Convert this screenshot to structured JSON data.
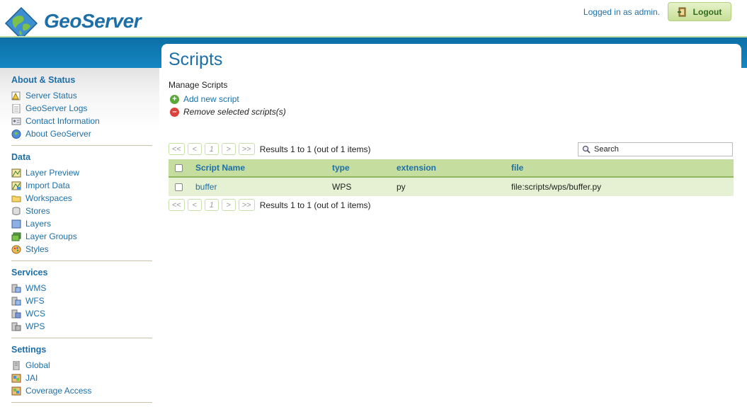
{
  "header": {
    "brand": "GeoServer",
    "logged_in": "Logged in as admin.",
    "logout_label": "Logout"
  },
  "sidebar": {
    "sections": [
      {
        "title": "About & Status",
        "items": [
          {
            "label": "Server Status",
            "icon": "server-status-icon"
          },
          {
            "label": "GeoServer Logs",
            "icon": "logs-icon"
          },
          {
            "label": "Contact Information",
            "icon": "contact-icon"
          },
          {
            "label": "About GeoServer",
            "icon": "about-icon"
          }
        ]
      },
      {
        "title": "Data",
        "items": [
          {
            "label": "Layer Preview",
            "icon": "layer-preview-icon"
          },
          {
            "label": "Import Data",
            "icon": "import-data-icon"
          },
          {
            "label": "Workspaces",
            "icon": "folder-icon"
          },
          {
            "label": "Stores",
            "icon": "store-icon"
          },
          {
            "label": "Layers",
            "icon": "layers-icon"
          },
          {
            "label": "Layer Groups",
            "icon": "layer-groups-icon"
          },
          {
            "label": "Styles",
            "icon": "styles-icon"
          }
        ]
      },
      {
        "title": "Services",
        "items": [
          {
            "label": "WMS",
            "icon": "wms-icon"
          },
          {
            "label": "WFS",
            "icon": "wfs-icon"
          },
          {
            "label": "WCS",
            "icon": "wcs-icon"
          },
          {
            "label": "WPS",
            "icon": "wps-icon"
          }
        ]
      },
      {
        "title": "Settings",
        "items": [
          {
            "label": "Global",
            "icon": "global-icon"
          },
          {
            "label": "JAI",
            "icon": "jai-icon"
          },
          {
            "label": "Coverage Access",
            "icon": "coverage-access-icon"
          }
        ]
      }
    ]
  },
  "main": {
    "title": "Scripts",
    "subtitle": "Manage Scripts",
    "add_label": "Add new script",
    "remove_label": "Remove selected scripts(s)",
    "pager": {
      "first": "<<",
      "prev": "<",
      "page": "1",
      "next": ">",
      "last": ">>",
      "results": "Results 1 to 1 (out of 1 items)"
    },
    "search_placeholder": "Search",
    "table": {
      "columns": [
        "Script Name",
        "type",
        "extension",
        "file"
      ],
      "rows": [
        {
          "name": "buffer",
          "type": "WPS",
          "extension": "py",
          "file": "file:scripts/wps/buffer.py"
        }
      ]
    }
  },
  "colors": {
    "brand_blue": "#1d6fa8",
    "band_blue": "#0d6fa5",
    "table_header": "#c5dd9f",
    "row_bg": "#e6f1d4"
  }
}
